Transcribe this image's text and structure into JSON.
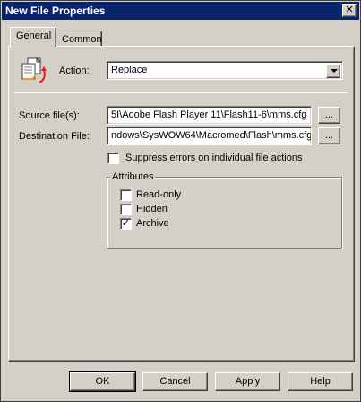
{
  "window": {
    "title": "New File Properties",
    "close_glyph": "✕"
  },
  "tabs": [
    {
      "label": "General",
      "active": true
    },
    {
      "label": "Common",
      "active": false
    }
  ],
  "action": {
    "icon": "file-replace-icon",
    "label": "Action:",
    "value": "Replace"
  },
  "source": {
    "label": "Source file(s):",
    "value": "5I\\Adobe Flash Player 11\\Flash11-6\\mms.cfg",
    "browse_label": "..."
  },
  "destination": {
    "label": "Destination File:",
    "value": "ndows\\SysWOW64\\Macromed\\Flash\\mms.cfg",
    "browse_label": "..."
  },
  "suppress_errors": {
    "label": "Suppress errors on individual file actions",
    "checked": false
  },
  "attributes": {
    "title": "Attributes",
    "items": [
      {
        "label": "Read-only",
        "checked": false
      },
      {
        "label": "Hidden",
        "checked": false
      },
      {
        "label": "Archive",
        "checked": true
      }
    ]
  },
  "buttons": {
    "ok": "OK",
    "cancel": "Cancel",
    "apply": "Apply",
    "help": "Help"
  },
  "check_glyph": "✓"
}
